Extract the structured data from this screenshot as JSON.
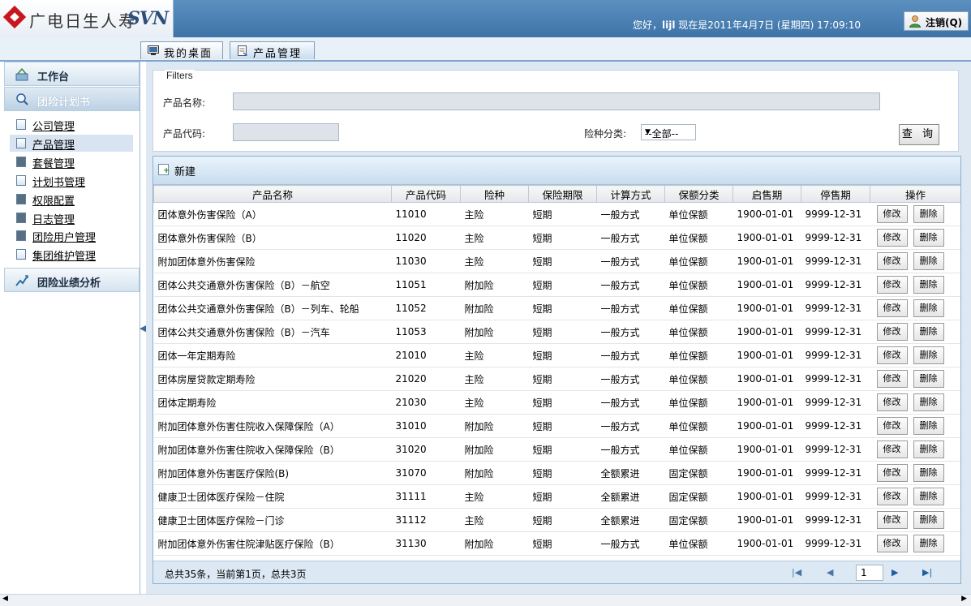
{
  "header": {
    "logo_text": "广电日生人寿",
    "logo_sub": "SVN",
    "greeting_prefix": "您好，",
    "user": "lijl",
    "greeting_suffix": " 现在是2011年4月7日 (星期四) 17:09:10",
    "logout_label": "注销(Q)"
  },
  "tabs": [
    {
      "label": "我的桌面"
    },
    {
      "label": "产品管理"
    }
  ],
  "sidebar": {
    "workbench": "工作台",
    "plan": "团险计划书",
    "analysis": "团险业绩分析",
    "items": [
      {
        "label": "公司管理"
      },
      {
        "label": "产品管理"
      },
      {
        "label": "套餐管理"
      },
      {
        "label": "计划书管理"
      },
      {
        "label": "权限配置"
      },
      {
        "label": "日志管理"
      },
      {
        "label": "团险用户管理"
      },
      {
        "label": "集团维护管理"
      }
    ]
  },
  "filters": {
    "legend": "Filters",
    "product_name_label": "产品名称:",
    "product_name_value": "",
    "product_code_label": "产品代码:",
    "product_code_value": "",
    "category_label": "险种分类:",
    "category_value": "--全部--",
    "query_label": "查 询"
  },
  "toolbar": {
    "new_label": "新建"
  },
  "table": {
    "headers": [
      "产品名称",
      "产品代码",
      "险种",
      "保险期限",
      "计算方式",
      "保额分类",
      "启售期",
      "停售期",
      "操作"
    ],
    "edit_label": "修改",
    "delete_label": "删除",
    "rows": [
      [
        "团体意外伤害保险（A）",
        "11010",
        "主险",
        "短期",
        "一般方式",
        "单位保额",
        "1900-01-01",
        "9999-12-31"
      ],
      [
        "团体意外伤害保险（B）",
        "11020",
        "主险",
        "短期",
        "一般方式",
        "单位保额",
        "1900-01-01",
        "9999-12-31"
      ],
      [
        "附加团体意外伤害保险",
        "11030",
        "主险",
        "短期",
        "一般方式",
        "单位保额",
        "1900-01-01",
        "9999-12-31"
      ],
      [
        "团体公共交通意外伤害保险（B）－航空",
        "11051",
        "附加险",
        "短期",
        "一般方式",
        "单位保额",
        "1900-01-01",
        "9999-12-31"
      ],
      [
        "团体公共交通意外伤害保险（B）－列车、轮船",
        "11052",
        "附加险",
        "短期",
        "一般方式",
        "单位保额",
        "1900-01-01",
        "9999-12-31"
      ],
      [
        "团体公共交通意外伤害保险（B）－汽车",
        "11053",
        "附加险",
        "短期",
        "一般方式",
        "单位保额",
        "1900-01-01",
        "9999-12-31"
      ],
      [
        "团体一年定期寿险",
        "21010",
        "主险",
        "短期",
        "一般方式",
        "单位保额",
        "1900-01-01",
        "9999-12-31"
      ],
      [
        "团体房屋贷款定期寿险",
        "21020",
        "主险",
        "短期",
        "一般方式",
        "单位保额",
        "1900-01-01",
        "9999-12-31"
      ],
      [
        "团体定期寿险",
        "21030",
        "主险",
        "短期",
        "一般方式",
        "单位保额",
        "1900-01-01",
        "9999-12-31"
      ],
      [
        "附加团体意外伤害住院收入保障保险（A）",
        "31010",
        "附加险",
        "短期",
        "一般方式",
        "单位保额",
        "1900-01-01",
        "9999-12-31"
      ],
      [
        "附加团体意外伤害住院收入保障保险（B）",
        "31020",
        "附加险",
        "短期",
        "一般方式",
        "单位保额",
        "1900-01-01",
        "9999-12-31"
      ],
      [
        "附加团体意外伤害医疗保险(B)",
        "31070",
        "附加险",
        "短期",
        "全额累进",
        "固定保额",
        "1900-01-01",
        "9999-12-31"
      ],
      [
        "健康卫士团体医疗保险－住院",
        "31111",
        "主险",
        "短期",
        "全额累进",
        "固定保额",
        "1900-01-01",
        "9999-12-31"
      ],
      [
        "健康卫士团体医疗保险－门诊",
        "31112",
        "主险",
        "短期",
        "全额累进",
        "固定保额",
        "1900-01-01",
        "9999-12-31"
      ],
      [
        "附加团体意外伤害住院津贴医疗保险（B）",
        "31130",
        "附加险",
        "短期",
        "一般方式",
        "单位保额",
        "1900-01-01",
        "9999-12-31"
      ]
    ]
  },
  "pager": {
    "summary": "总共35条，当前第1页，总共3页",
    "current_page": "1"
  }
}
